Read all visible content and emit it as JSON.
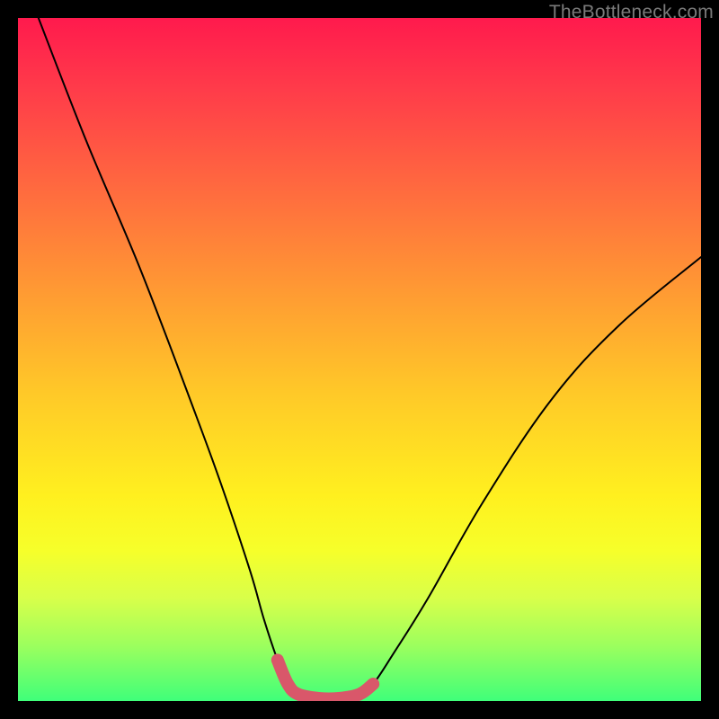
{
  "watermark": "TheBottleneck.com",
  "chart_data": {
    "type": "line",
    "title": "",
    "xlabel": "",
    "ylabel": "",
    "xlim": [
      0,
      100
    ],
    "ylim": [
      0,
      100
    ],
    "series": [
      {
        "name": "bottleneck-curve",
        "x": [
          3,
          10,
          18,
          26,
          30,
          34,
          36,
          38,
          39.5,
          41,
          44,
          47,
          50,
          52,
          55,
          60,
          68,
          78,
          88,
          100
        ],
        "y": [
          100,
          82,
          63,
          42,
          31,
          19,
          12,
          6,
          2.5,
          1,
          0.4,
          0.4,
          1,
          2.5,
          7,
          15,
          29,
          44,
          55,
          65
        ]
      },
      {
        "name": "highlight-trough",
        "x": [
          38,
          39.5,
          41,
          44,
          47,
          50,
          52
        ],
        "y": [
          6,
          2.5,
          1,
          0.4,
          0.4,
          1,
          2.5
        ]
      }
    ],
    "annotations": []
  }
}
